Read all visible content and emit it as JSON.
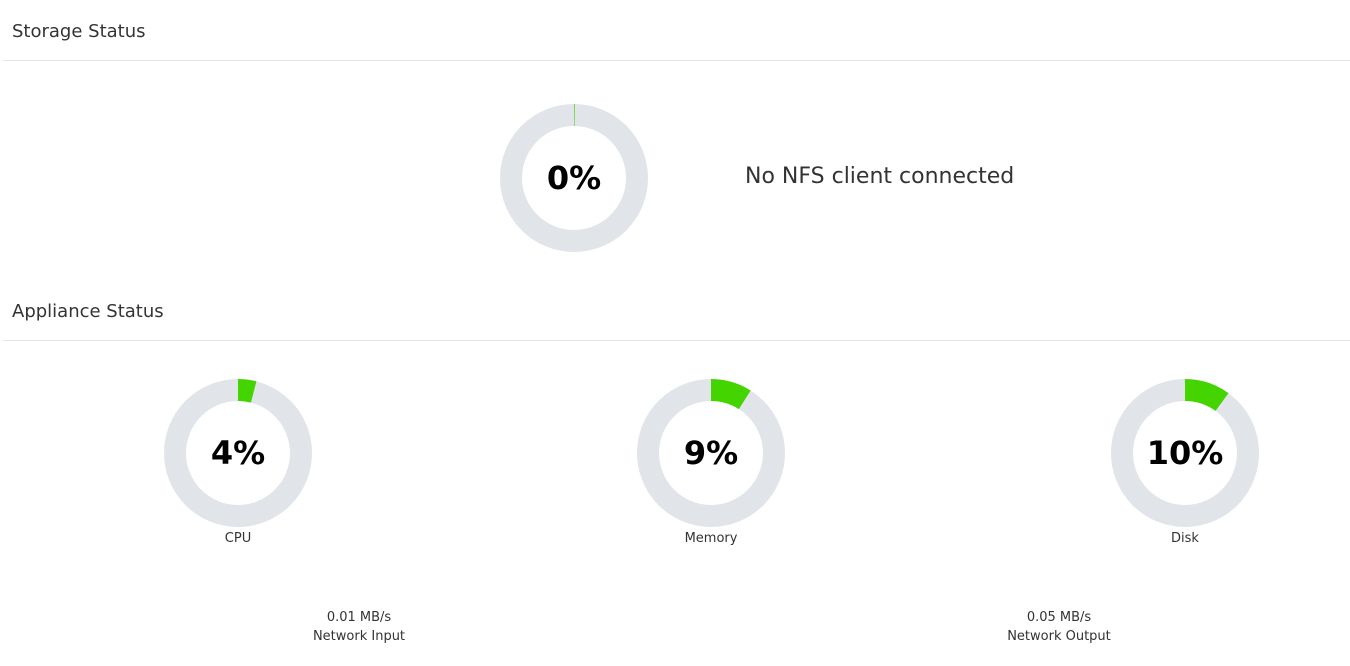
{
  "storage": {
    "title": "Storage Status",
    "usage": {
      "value": 0,
      "label": "0%"
    },
    "nfs_message": "No NFS client connected"
  },
  "appliance": {
    "title": "Appliance Status",
    "gauges": [
      {
        "key": "cpu",
        "value": 4,
        "label": "4%",
        "name": "CPU"
      },
      {
        "key": "memory",
        "value": 9,
        "label": "9%",
        "name": "Memory"
      },
      {
        "key": "disk",
        "value": 10,
        "label": "10%",
        "name": "Disk"
      }
    ],
    "network_input": {
      "value": "0.01 MB/s",
      "label": "Network Input"
    },
    "network_output": {
      "value": "0.05 MB/s",
      "label": "Network Output"
    }
  },
  "colors": {
    "track": "#e1e4e8",
    "fill": "#44d400"
  }
}
